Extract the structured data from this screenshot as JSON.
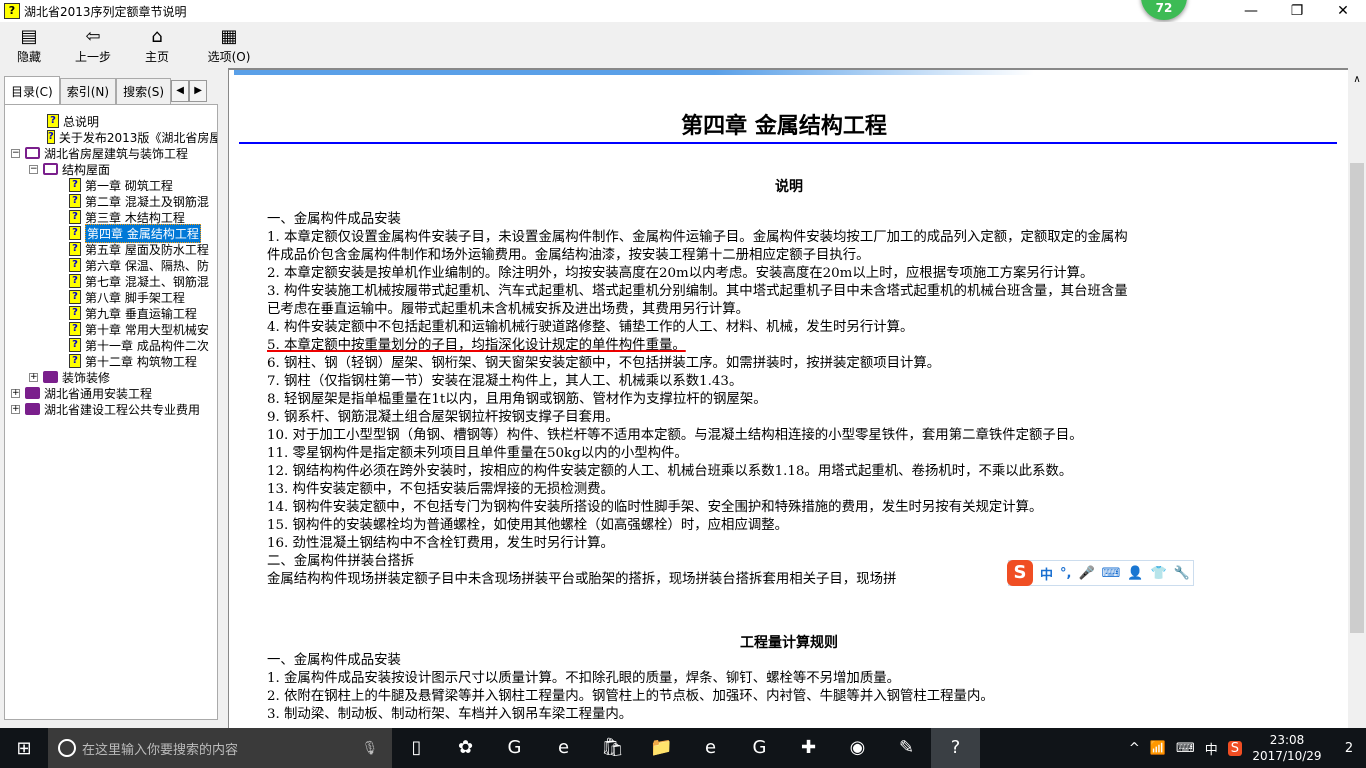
{
  "window": {
    "title": "湖北省2013序列定额章节说明",
    "badge": "72",
    "minimize": "—",
    "restore": "❐",
    "close": "✕"
  },
  "toolbar": [
    {
      "label": "隐藏",
      "icon": "hide-icon",
      "glyph": "▤"
    },
    {
      "label": "上一步",
      "icon": "back-arrow-icon",
      "glyph": "⇦"
    },
    {
      "label": "主页",
      "icon": "home-icon",
      "glyph": "⌂"
    },
    {
      "label": "选项(O)",
      "icon": "options-icon",
      "glyph": "▦"
    }
  ],
  "tabs": [
    {
      "label": "目录(C)"
    },
    {
      "label": "索引(N)"
    },
    {
      "label": "搜索(S)"
    }
  ],
  "tab_arrows": {
    "left": "◀",
    "right": "▶"
  },
  "tree": [
    {
      "label": "总说明",
      "level": 1,
      "type": "page"
    },
    {
      "label": "关于发布2013版《湖北省房屋",
      "level": 1,
      "type": "page"
    },
    {
      "label": "湖北省房屋建筑与装饰工程",
      "level": 0,
      "type": "book-open",
      "exp": "−"
    },
    {
      "label": "结构屋面",
      "level": 1,
      "type": "book-open",
      "exp": "−"
    },
    {
      "label": "第一章  砌筑工程",
      "level": 2,
      "type": "page"
    },
    {
      "label": "第二章  混凝土及钢筋混",
      "level": 2,
      "type": "page"
    },
    {
      "label": "第三章  木结构工程",
      "level": 2,
      "type": "page"
    },
    {
      "label": "第四章  金属结构工程",
      "level": 2,
      "type": "page",
      "selected": true
    },
    {
      "label": "第五章  屋面及防水工程",
      "level": 2,
      "type": "page"
    },
    {
      "label": "第六章  保温、隔热、防",
      "level": 2,
      "type": "page"
    },
    {
      "label": "第七章  混凝土、钢筋混",
      "level": 2,
      "type": "page"
    },
    {
      "label": "第八章  脚手架工程",
      "level": 2,
      "type": "page"
    },
    {
      "label": "第九章  垂直运输工程",
      "level": 2,
      "type": "page"
    },
    {
      "label": "第十章  常用大型机械安",
      "level": 2,
      "type": "page"
    },
    {
      "label": "第十一章  成品构件二次",
      "level": 2,
      "type": "page"
    },
    {
      "label": "第十二章  构筑物工程",
      "level": 2,
      "type": "page"
    },
    {
      "label": "装饰装修",
      "level": 1,
      "type": "book",
      "exp": "+"
    },
    {
      "label": "湖北省通用安装工程",
      "level": 0,
      "type": "book",
      "exp": "+"
    },
    {
      "label": "湖北省建设工程公共专业费用",
      "level": 0,
      "type": "book",
      "exp": "+"
    }
  ],
  "content": {
    "chapter_title": "第四章  金属结构工程",
    "section1_title": "说明",
    "section1_lines": [
      "一、金属构件成品安装",
      "1. 本章定额仅设置金属构件安装子目，未设置金属构件制作、金属构件运输子目。金属构件安装均按工厂加工的成品列入定额，定额取定的金属构",
      "件成品价包含金属构件制作和场外运输费用。金属结构油漆，按安装工程第十二册相应定额子目执行。",
      "2. 本章定额安装是按单机作业编制的。除注明外，均按安装高度在20m以内考虑。安装高度在20m以上时，应根据专项施工方案另行计算。",
      "3. 构件安装施工机械按履带式起重机、汽车式起重机、塔式起重机分别编制。其中塔式起重机子目中未含塔式起重机的机械台班含量，其台班含量",
      "已考虑在垂直运输中。履带式起重机未含机械安拆及进出场费，其费用另行计算。",
      "4. 构件安装定额中不包括起重机和运输机械行驶道路修整、铺垫工作的人工、材料、机械，发生时另行计算。",
      "5. 本章定额中按重量划分的子目，均指深化设计规定的单件构件重量。",
      "6. 钢柱、钢（轻钢）屋架、钢桁架、钢天窗架安装定额中，不包括拼装工序。如需拼装时，按拼装定额项目计算。",
      "7. 钢柱（仅指钢柱第一节）安装在混凝土构件上，其人工、机械乘以系数1.43。",
      "8. 轻钢屋架是指单榀重量在1t以内，且用角钢或钢筋、管材作为支撑拉杆的钢屋架。",
      "9. 钢系杆、钢筋混凝土组合屋架钢拉杆按钢支撑子目套用。",
      "10. 对于加工小型型钢（角钢、槽钢等）构件、铁栏杆等不适用本定额。与混凝土结构相连接的小型零星铁件，套用第二章铁件定额子目。",
      "11. 零星钢构件是指定额未列项目且单件重量在50kg以内的小型构件。",
      "12. 钢结构构件必须在跨外安装时，按相应的构件安装定额的人工、机械台班乘以系数1.18。用塔式起重机、卷扬机时，不乘以此系数。",
      "13. 构件安装定额中，不包括安装后需焊接的无损检测费。",
      "14. 钢构件安装定额中，不包括专门为钢构件安装所搭设的临时性脚手架、安全围护和特殊措施的费用，发生时另按有关规定计算。",
      "15. 钢构件的安装螺栓均为普通螺栓，如使用其他螺栓（如高强螺栓）时，应相应调整。",
      "16. 劲性混凝土钢结构中不含栓钉费用，发生时另行计算。",
      "二、金属构件拼装台搭拆",
      "金属结构构件现场拼装定额子目中未含现场拼装平台或胎架的搭拆，现场拼装台搭拆套用相关子目，现场拼"
    ],
    "section2_title": "工程量计算规则",
    "section2_lines": [
      "一、金属构件成品安装",
      "1. 金属构件成品安装按设计图示尺寸以质量计算。不扣除孔眼的质量，焊条、铆钉、螺栓等不另增加质量。",
      "2. 依附在钢柱上的牛腿及悬臂梁等并入钢柱工程量内。钢管柱上的节点板、加强环、内衬管、牛腿等并入钢管柱工程量内。",
      "3. 制动梁、制动板、制动桁架、车档并入钢吊车梁工程量内。"
    ]
  },
  "ime": {
    "logo": "S",
    "mode": "中",
    "punct": "°,",
    "mic": "🎤",
    "keyboard": "⌨",
    "user": "👤",
    "skin": "👕",
    "tools": "🔧"
  },
  "taskbar": {
    "start": "⊞",
    "search_placeholder": "在这里输入你要搜索的内容",
    "mic": "🎙",
    "apps": [
      {
        "name": "task-view",
        "glyph": "▯"
      },
      {
        "name": "fan-app",
        "glyph": "✿"
      },
      {
        "name": "swirl-app",
        "glyph": "G"
      },
      {
        "name": "edge",
        "glyph": "e"
      },
      {
        "name": "store",
        "glyph": "🛍"
      },
      {
        "name": "file-explorer",
        "glyph": "📁"
      },
      {
        "name": "ie",
        "glyph": "e"
      },
      {
        "name": "sogou-browser",
        "glyph": "G"
      },
      {
        "name": "pin-app",
        "glyph": "✚"
      },
      {
        "name": "green-app",
        "glyph": "◉"
      },
      {
        "name": "notepad-app",
        "glyph": "✎"
      },
      {
        "name": "help-app",
        "glyph": "?"
      }
    ],
    "tray": {
      "chevron": "^",
      "network": "📶",
      "keyboard": "⌨",
      "ime": "中",
      "sogou": "S",
      "time": "23:08",
      "date": "2017/10/29",
      "notifications": "2"
    }
  }
}
